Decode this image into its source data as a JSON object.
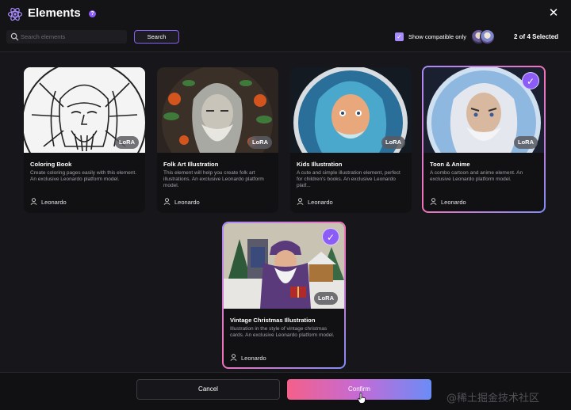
{
  "header": {
    "title": "Elements",
    "help_badge": "?",
    "close_glyph": "✕"
  },
  "search": {
    "placeholder": "Search elements",
    "value": "",
    "button_label": "Search"
  },
  "filter": {
    "show_compatible_label": "Show compatible only",
    "show_compatible_checked": true,
    "selected_count_label": "2 of 4 Selected"
  },
  "colors": {
    "accent_purple": "#8b5cf6",
    "gradient_pink": "#f472b6",
    "gradient_blue": "#6b8cf6"
  },
  "cards": [
    {
      "title": "Coloring Book",
      "description": "Create coloring pages easily with this element. An exclusive Leonardo platform model.",
      "badge": "LoRA",
      "author": "Leonardo",
      "selected": false
    },
    {
      "title": "Folk Art Illustration",
      "description": "This element will help you create folk art illustrations. An exclusive Leonardo platform model.",
      "badge": "LoRA",
      "author": "Leonardo",
      "selected": false
    },
    {
      "title": "Kids Illustration",
      "description": "A cute and simple illustration element, perfect for children's books. An exclusive Leonardo platf...",
      "badge": "LoRA",
      "author": "Leonardo",
      "selected": false
    },
    {
      "title": "Toon & Anime",
      "description": "A combo cartoon and anime element. An exclusive Leonardo platform model.",
      "badge": "LoRA",
      "author": "Leonardo",
      "selected": true
    },
    {
      "title": "Vintage Christmas Illustration",
      "description": "Illustration in the style of vintage christmas cards. An exclusive Leonardo platform model.",
      "badge": "LoRA",
      "author": "Leonardo",
      "selected": true
    }
  ],
  "footer": {
    "cancel_label": "Cancel",
    "confirm_label": "Confirm"
  },
  "watermark": "@稀土掘金技术社区",
  "icons": [
    "react-atom-icon",
    "search-icon",
    "checkbox-check-icon",
    "user-icon",
    "check-icon",
    "close-icon",
    "cursor-hand-icon"
  ]
}
